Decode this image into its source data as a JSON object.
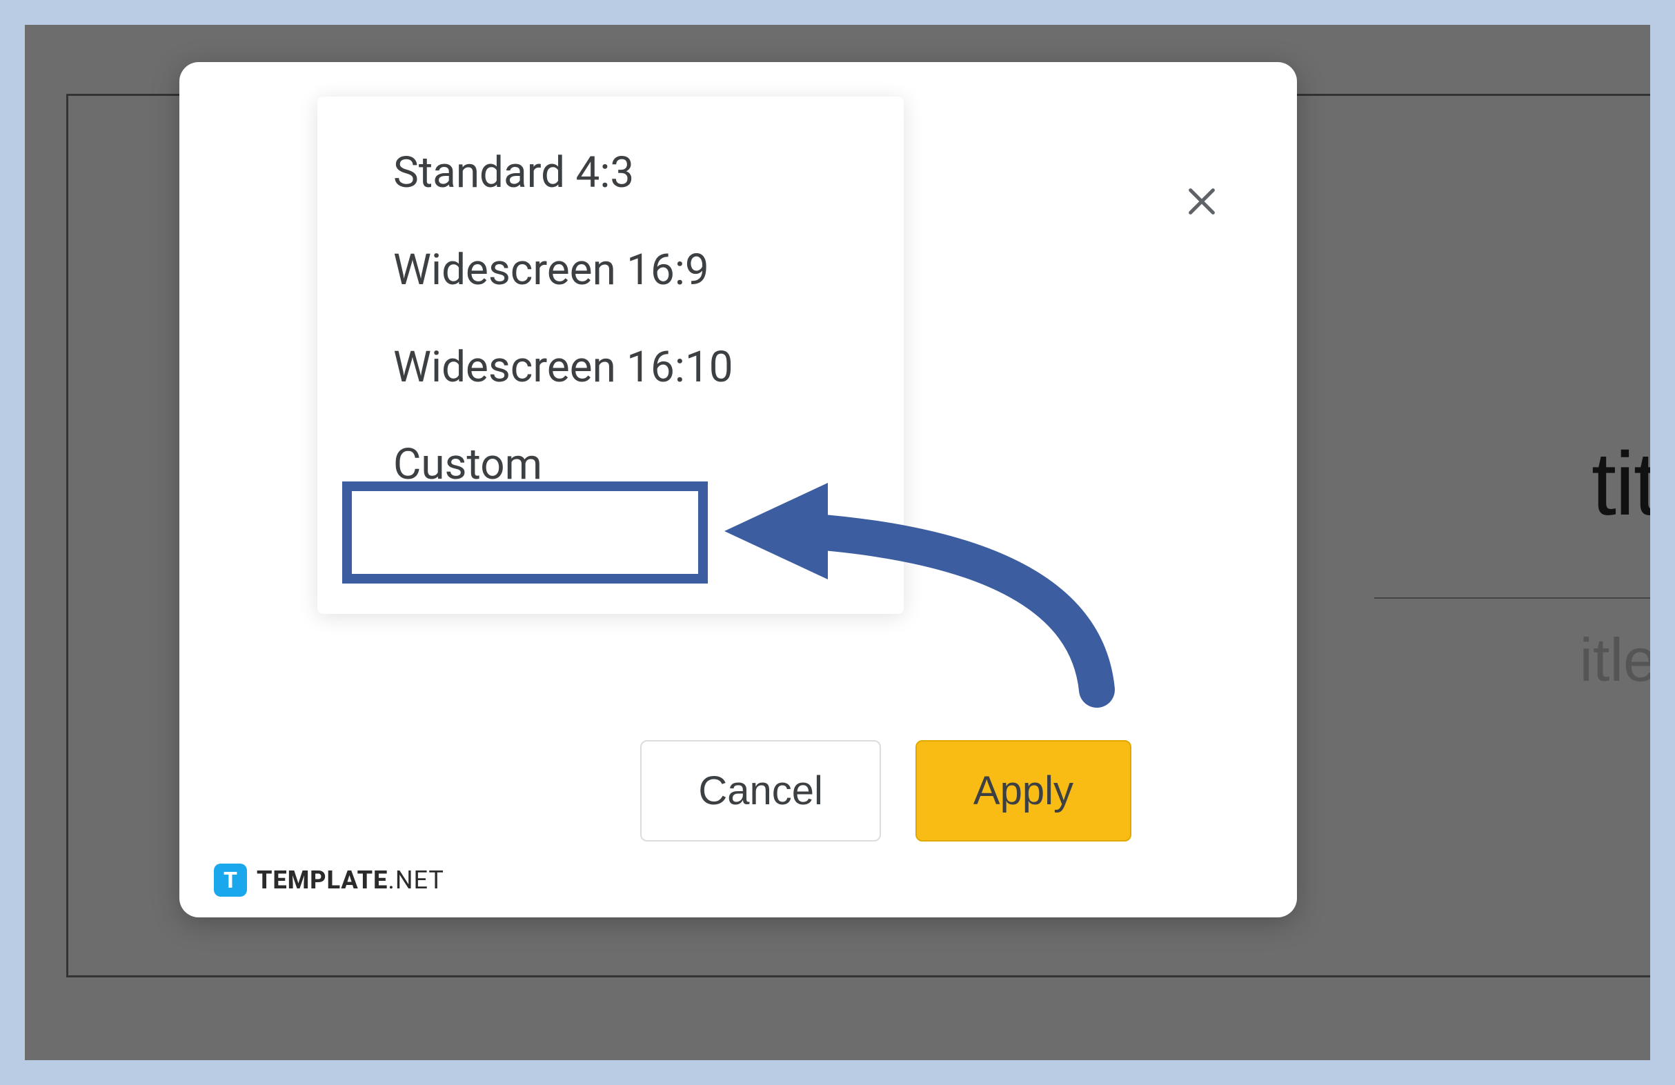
{
  "dropdown": {
    "options": [
      "Standard 4:3",
      "Widescreen 16:9",
      "Widescreen 16:10",
      "Custom"
    ],
    "highlighted_index": 3
  },
  "dialog": {
    "cancel_label": "Cancel",
    "apply_label": "Apply"
  },
  "background_slide": {
    "title_fragment": "tit",
    "subtitle_fragment": "itle"
  },
  "watermark": {
    "icon_letter": "T",
    "brand": "TEMPLATE",
    "tld": ".NET"
  },
  "annotation": {
    "arrow_color": "#3c5da0",
    "highlight_color": "#3c5da0"
  }
}
